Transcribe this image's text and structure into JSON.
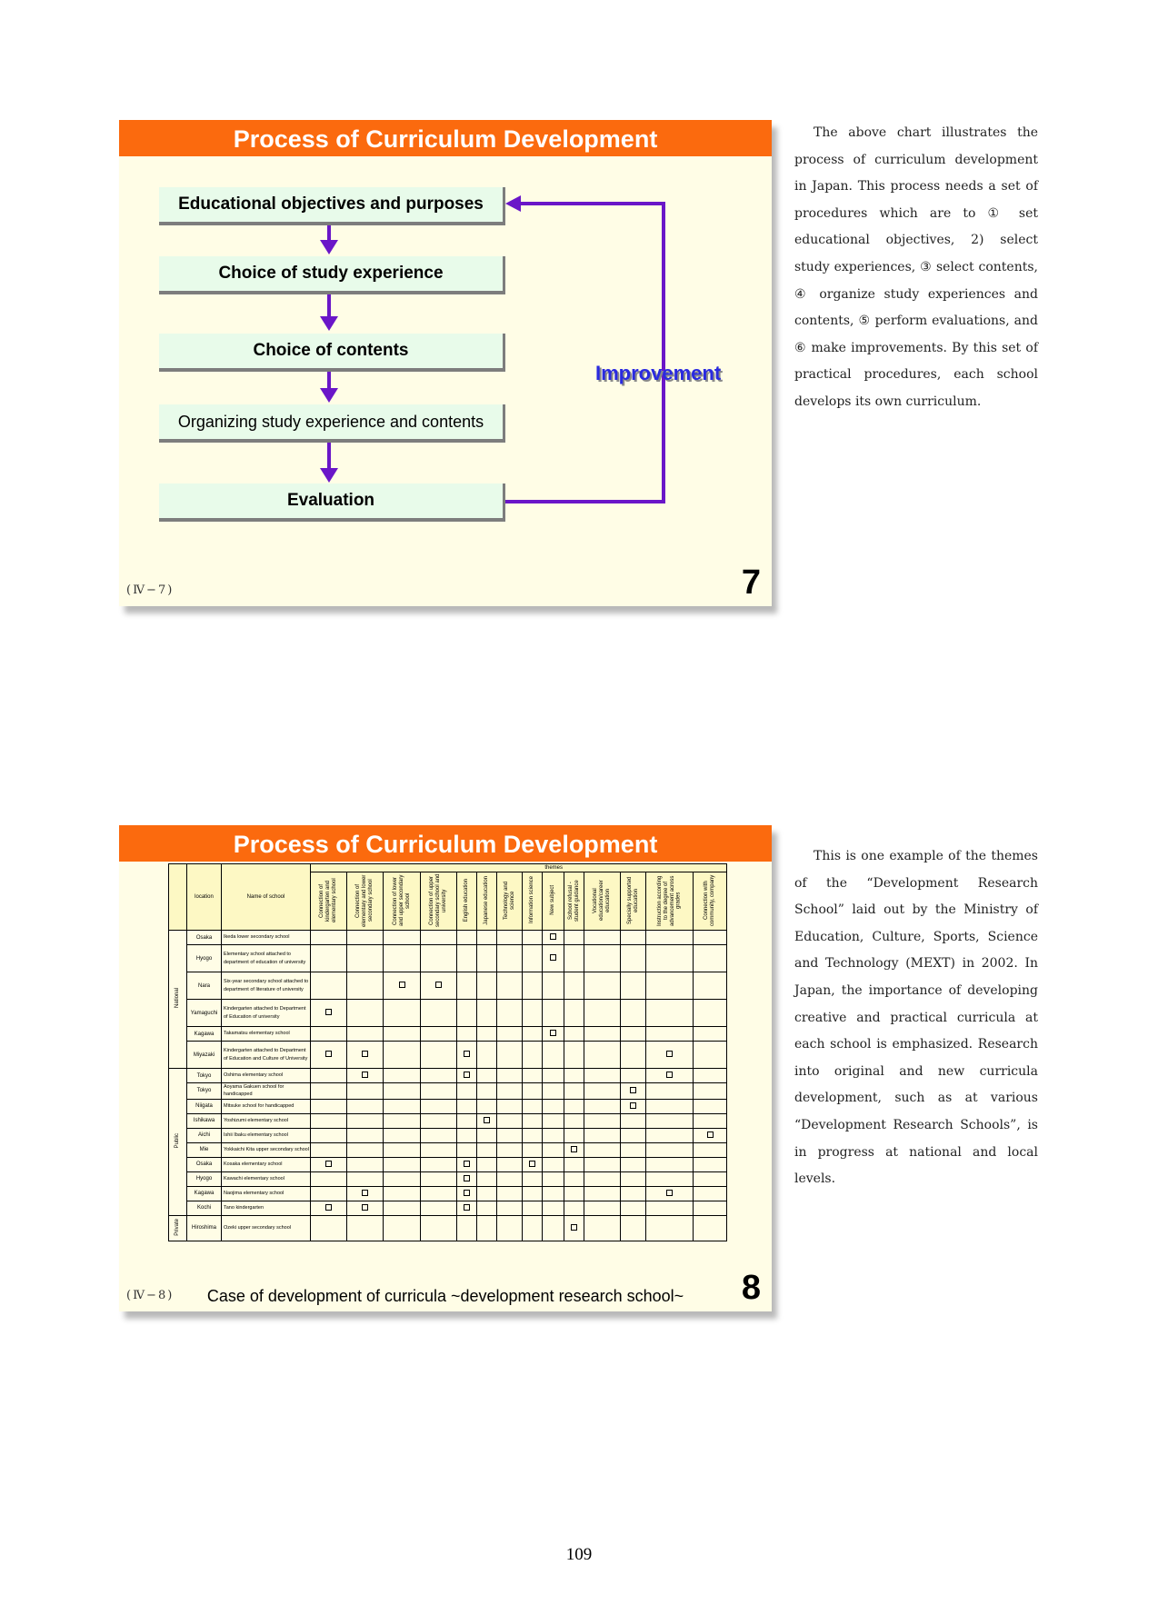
{
  "slide7": {
    "title": "Process of Curriculum Development",
    "steps": [
      "Educational objectives and purposes",
      "Choice of study experience",
      "Choice of contents",
      "Organizing study experience and contents",
      "Evaluation"
    ],
    "loop_label": "Improvement",
    "code": "(Ⅳ−7)",
    "number": "7",
    "colors": {
      "title_bar": "#fb6a0e",
      "arrow": "#6a16c8",
      "box": "#e8fbea",
      "loop_label": "#2a2ae0"
    }
  },
  "text7": "The above chart illustrates the process of curriculum development in Japan. This process needs a set of procedures which are to ① set educational objectives,  2) select study experiences, ③ select contents, ④ organize study experiences and contents, ⑤ perform evaluations, and ⑥ make improvements. By this set of practical procedures, each school develops its own curriculum.",
  "slide8": {
    "title": "Process of Curriculum Development",
    "table": {
      "themes_label": "themes",
      "location_header": "location",
      "name_header": "Name of school",
      "theme_headers": [
        "Connection of kindergarten and elementary school",
        "Connection of elementary and lower secondary school",
        "Connection of lower and upper secondary school",
        "Connection of upper secondary school and university",
        "English education",
        "Japanese education",
        "Technology and science",
        "Information science",
        "New subject",
        "School refusal - student guidance",
        "Vocational education/career education",
        "Specially supported education",
        "Instruction according to the degree of advancement across grades",
        "Connection with community, company"
      ],
      "groups": [
        {
          "category": "National",
          "rows": [
            {
              "location": "Osaka",
              "name": "Ikeda lower secondary school",
              "marks": [
                8
              ]
            },
            {
              "location": "Hyogo",
              "name": "Elementary school attached to department of education of university",
              "marks": [
                8
              ]
            },
            {
              "location": "Nara",
              "name": "Six-year secondary school attached to department of literature of university",
              "marks": [
                2,
                3
              ]
            },
            {
              "location": "Yamaguchi",
              "name": "Kindergarten attached to Department of Education of university",
              "marks": [
                0
              ]
            },
            {
              "location": "Kagawa",
              "name": "Takamatsu elementary school",
              "marks": [
                8
              ]
            },
            {
              "location": "Miyazaki",
              "name": "Kindergarten attached to Department of Education and Culture of University",
              "marks": [
                0,
                1,
                4,
                12
              ]
            }
          ]
        },
        {
          "category": "Public",
          "rows": [
            {
              "location": "Tokyo",
              "name": "Oshima elementary school",
              "marks": [
                1,
                4,
                12
              ]
            },
            {
              "location": "Tokyo",
              "name": "Aoyama Gakuen school for handicapped",
              "marks": [
                11
              ]
            },
            {
              "location": "Niigata",
              "name": "Mitsuke school for handicapped",
              "marks": [
                11
              ]
            },
            {
              "location": "Ishikawa",
              "name": "Yoshizumi elementary school",
              "marks": [
                5
              ]
            },
            {
              "location": "Aichi",
              "name": "Ishii Ibaku elementary school",
              "marks": [
                13
              ]
            },
            {
              "location": "Mie",
              "name": "Yokkaichi Kita upper secondary school",
              "marks": [
                9
              ]
            },
            {
              "location": "Osaka",
              "name": "Kosaka elementary school",
              "marks": [
                0,
                4,
                7
              ]
            },
            {
              "location": "Hyogo",
              "name": "Kawachi elementary school",
              "marks": [
                4
              ]
            },
            {
              "location": "Kagawa",
              "name": "Naojima elementary school",
              "marks": [
                1,
                4,
                12
              ]
            },
            {
              "location": "Kochi",
              "name": "Tano kindergarten",
              "marks": [
                0,
                1,
                4
              ]
            }
          ]
        },
        {
          "category": "Private",
          "rows": [
            {
              "location": "Hiroshima",
              "name": "Ozeki upper secondary school",
              "marks": [
                9
              ]
            }
          ]
        }
      ]
    },
    "caption": "Case of development of curricula ~development research school~",
    "code": "(Ⅳ−8)",
    "number": "8"
  },
  "text8": "This is one example of the themes of the “Development Research School” laid out by the Ministry of Education, Culture, Sports, Science and Technology (MEXT) in 2002. In Japan, the importance of developing creative and practical curricula at each school is emphasized. Research into original and new curricula development, such as at various “Development Research Schools”, is in progress at national and local levels.",
  "page_number": "109"
}
